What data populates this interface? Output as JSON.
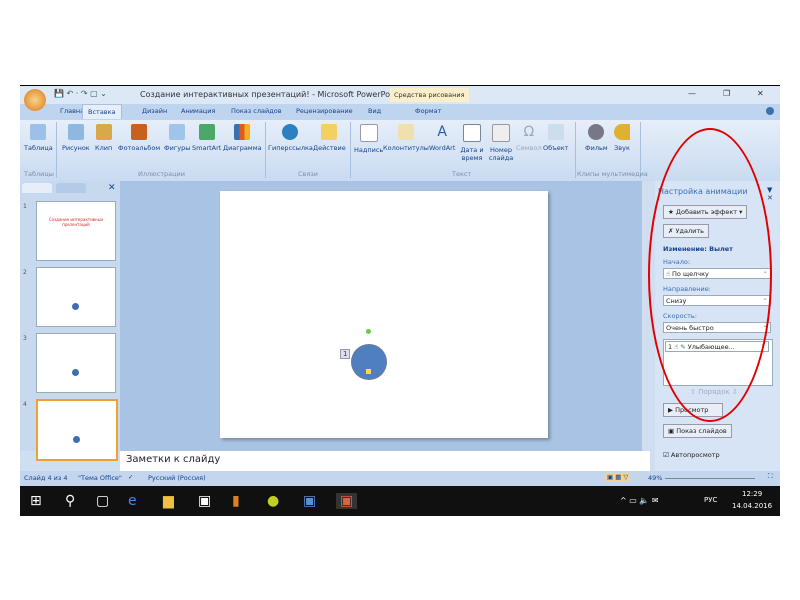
{
  "title_bar": {
    "title": "Создание интерактивных презентаций! - Microsoft PowerPoint",
    "context_tab": "Средства рисования",
    "minimize": "—",
    "maximize": "❐",
    "close": "✕"
  },
  "tabs": [
    "Главная",
    "Вставка",
    "Дизайн",
    "Анимация",
    "Показ слайдов",
    "Рецензирование",
    "Вид",
    "Формат"
  ],
  "ribbon": {
    "buttons": [
      "Таблица",
      "Рисунок",
      "Клип",
      "Фотоальбом",
      "Фигуры",
      "SmartArt",
      "Диаграмма",
      "Гиперссылка",
      "Действие",
      "Надпись",
      "Колонтитулы",
      "WordArt",
      "Дата и время",
      "Номер слайда",
      "Символ",
      "Объект",
      "Фильм",
      "Звук"
    ],
    "groups": [
      "Таблицы",
      "Иллюстрации",
      "Связи",
      "Текст",
      "Клипы мультимедиа"
    ]
  },
  "thumbnails": {
    "close": "✕",
    "slides": [
      {
        "num": "1",
        "text": "Создание интерактивных презентаций"
      },
      {
        "num": "2"
      },
      {
        "num": "3"
      },
      {
        "num": "4"
      }
    ]
  },
  "slide": {
    "anim_tag": "1"
  },
  "notes": {
    "placeholder": "Заметки к слайду"
  },
  "pane": {
    "title": "Настройка анимации",
    "add_effect": "Добавить эффект",
    "remove": "Удалить",
    "change": "Изменение: Вылет",
    "start_label": "Начало:",
    "start": "По щелчку",
    "direction_label": "Направление:",
    "direction": "Снизу",
    "speed_label": "Скорость:",
    "speed": "Очень быстро",
    "item_num": "1",
    "item": "Улыбающее...",
    "order": "Порядок",
    "preview": "Просмотр",
    "slideshow": "Показ слайдов",
    "autopreview": "Автопросмотр"
  },
  "status": {
    "slide": "Слайд 4 из 4",
    "theme": "\"Тема Office\"",
    "lang": "Русский (Россия)",
    "zoom": "49%"
  },
  "taskbar": {
    "lang": "РУС",
    "time": "12:29",
    "date": "14.04.2016"
  },
  "colors": {
    "annotation": "#e00000"
  }
}
